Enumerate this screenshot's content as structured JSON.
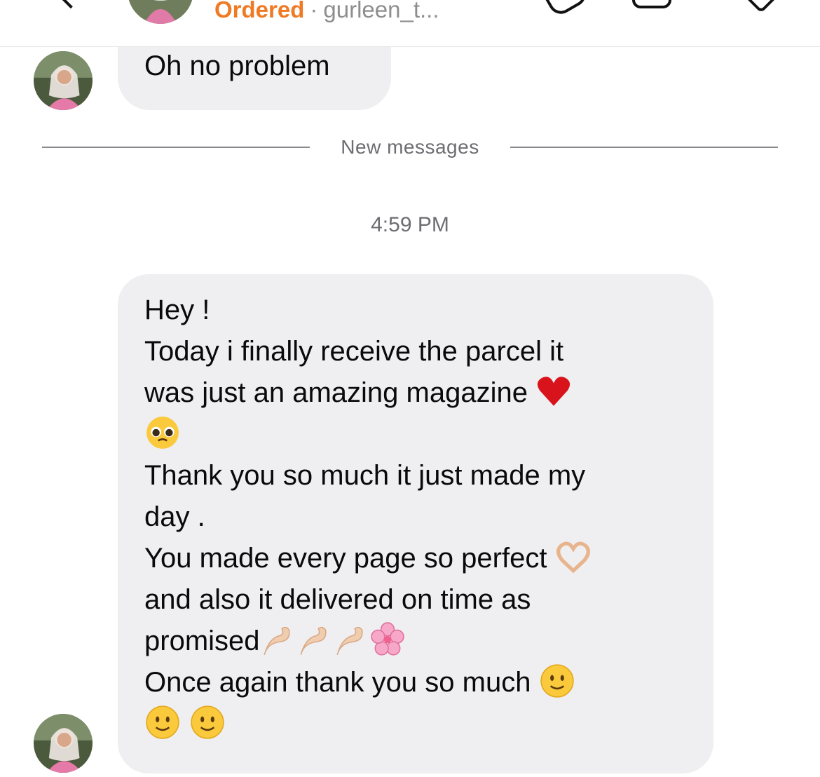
{
  "header": {
    "status": "Ordered",
    "separator": "·",
    "username": "gurleen_t..."
  },
  "messages": [
    {
      "id": "msg-1",
      "lines": [
        "Oh no problem"
      ]
    }
  ],
  "divider": {
    "label": "New messages"
  },
  "timestamp": "4:59 PM",
  "message2": {
    "line_1": "Hey !",
    "line_2": "Today i finally receive the parcel it",
    "line_3": "was just an amazing magazine ",
    "line_5": "Thank you so much it just made my",
    "line_6": "day .",
    "line_7": "You made every page so perfect ",
    "line_8": "and also it delivered on time as",
    "line_9": "promised",
    "line_10": "Once again thank you so much "
  },
  "icons": [
    "back-icon",
    "avatar",
    "phone-icon",
    "video-icon",
    "flag-icon",
    "heart-emoji",
    "pleading-face-emoji",
    "heart-hands-emoji",
    "pinching-hand-emoji",
    "cherry-blossom-emoji",
    "smiling-face-emoji"
  ],
  "colors": {
    "status": "#f07a24",
    "bubble": "#efeff1",
    "meta_text": "#6d6d72"
  }
}
